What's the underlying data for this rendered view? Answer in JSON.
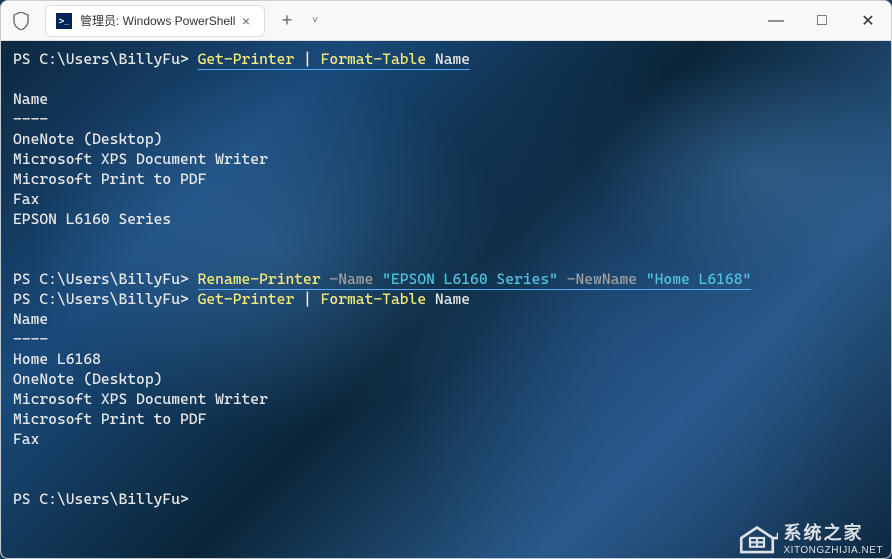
{
  "titlebar": {
    "tab_title": "管理员: Windows PowerShell",
    "tab_icon_label": ">_",
    "close_glyph": "×",
    "new_tab_glyph": "+",
    "dropdown_glyph": "˅"
  },
  "window_controls": {
    "minimize": "—",
    "maximize": "□",
    "close": "✕"
  },
  "terminal": {
    "prompt": "PS C:\\Users\\BillyFu> ",
    "lines": [
      {
        "type": "cmd1",
        "prompt": "PS C:\\Users\\BillyFu> ",
        "cmd1": "Get-Printer",
        "pipe": " | ",
        "cmd2": "Format-Table",
        "arg": " Name"
      },
      {
        "type": "blank"
      },
      {
        "type": "out",
        "text": "Name"
      },
      {
        "type": "out",
        "text": "----"
      },
      {
        "type": "out",
        "text": "OneNote (Desktop)"
      },
      {
        "type": "out",
        "text": "Microsoft XPS Document Writer"
      },
      {
        "type": "out",
        "text": "Microsoft Print to PDF"
      },
      {
        "type": "out",
        "text": "Fax"
      },
      {
        "type": "out",
        "text": "EPSON L6160 Series"
      },
      {
        "type": "blank"
      },
      {
        "type": "blank"
      },
      {
        "type": "cmd2",
        "prompt": "PS C:\\Users\\BillyFu> ",
        "cmd": "Rename-Printer",
        "p1": " -Name ",
        "s1": "\"EPSON L6160 Series\"",
        "p2": " -NewName ",
        "s2": "\"Home L6168\""
      },
      {
        "type": "cmd1b",
        "prompt": "PS C:\\Users\\BillyFu> ",
        "cmd1": "Get-Printer",
        "pipe": " | ",
        "cmd2": "Format-Table",
        "arg": " Name"
      },
      {
        "type": "out",
        "text": "Name"
      },
      {
        "type": "out",
        "text": "----"
      },
      {
        "type": "out",
        "text": "Home L6168"
      },
      {
        "type": "out",
        "text": "OneNote (Desktop)"
      },
      {
        "type": "out",
        "text": "Microsoft XPS Document Writer"
      },
      {
        "type": "out",
        "text": "Microsoft Print to PDF"
      },
      {
        "type": "out",
        "text": "Fax"
      },
      {
        "type": "blank"
      },
      {
        "type": "blank"
      },
      {
        "type": "promptonly",
        "prompt": "PS C:\\Users\\BillyFu>"
      }
    ]
  },
  "watermark": {
    "cn": "系统之家",
    "url": "XITONGZHIJIA.NET"
  }
}
